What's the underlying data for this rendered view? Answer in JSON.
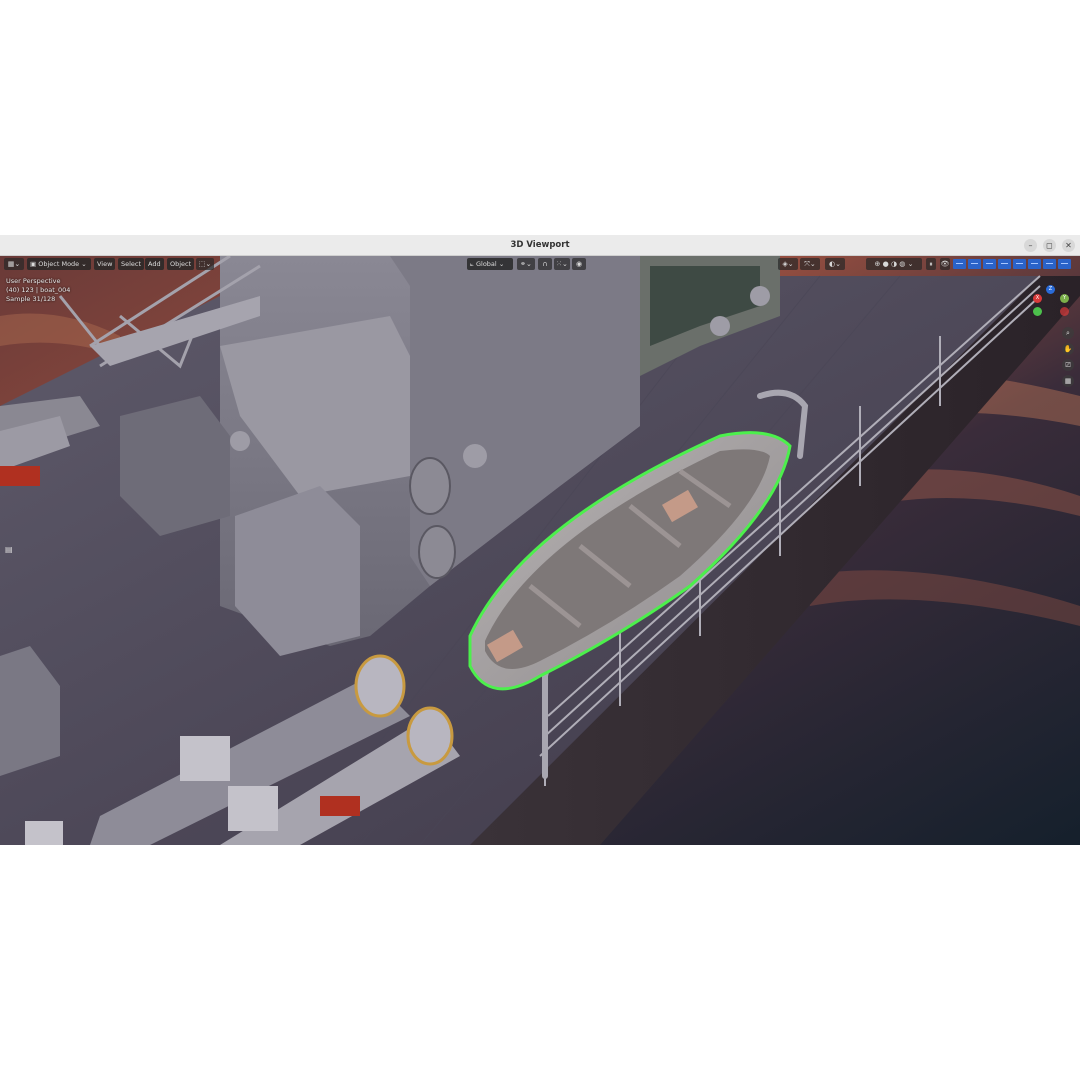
{
  "window": {
    "title": "3D Viewport",
    "controls": {
      "minimize": "–",
      "maximize": "◻",
      "close": "✕"
    }
  },
  "header": {
    "editor_type_icon": "editor-type-icon",
    "mode": {
      "icon": "object-mode-icon",
      "label": "Object Mode",
      "chevron": "⌄"
    },
    "menus": [
      "View",
      "Select",
      "Add",
      "Object"
    ],
    "transform_orientation": {
      "icon": "transform-orientation-icon",
      "label": "Global",
      "chevron": "⌄"
    },
    "pivot_icon": "pivot-icon",
    "snap_icon": "snap-icon",
    "proportional_icon": "proportional-edit-icon"
  },
  "overlay": {
    "line1": "User Perspective",
    "line2": "(40) 123 | boat_004",
    "line3": "Sample 31/128"
  },
  "gizmo": {
    "x": "X",
    "y": "Y",
    "z": "Z"
  },
  "colors": {
    "selection_outline": "#4cf04c",
    "header_bg": "#282828",
    "shading_active": "#2a63c9"
  }
}
